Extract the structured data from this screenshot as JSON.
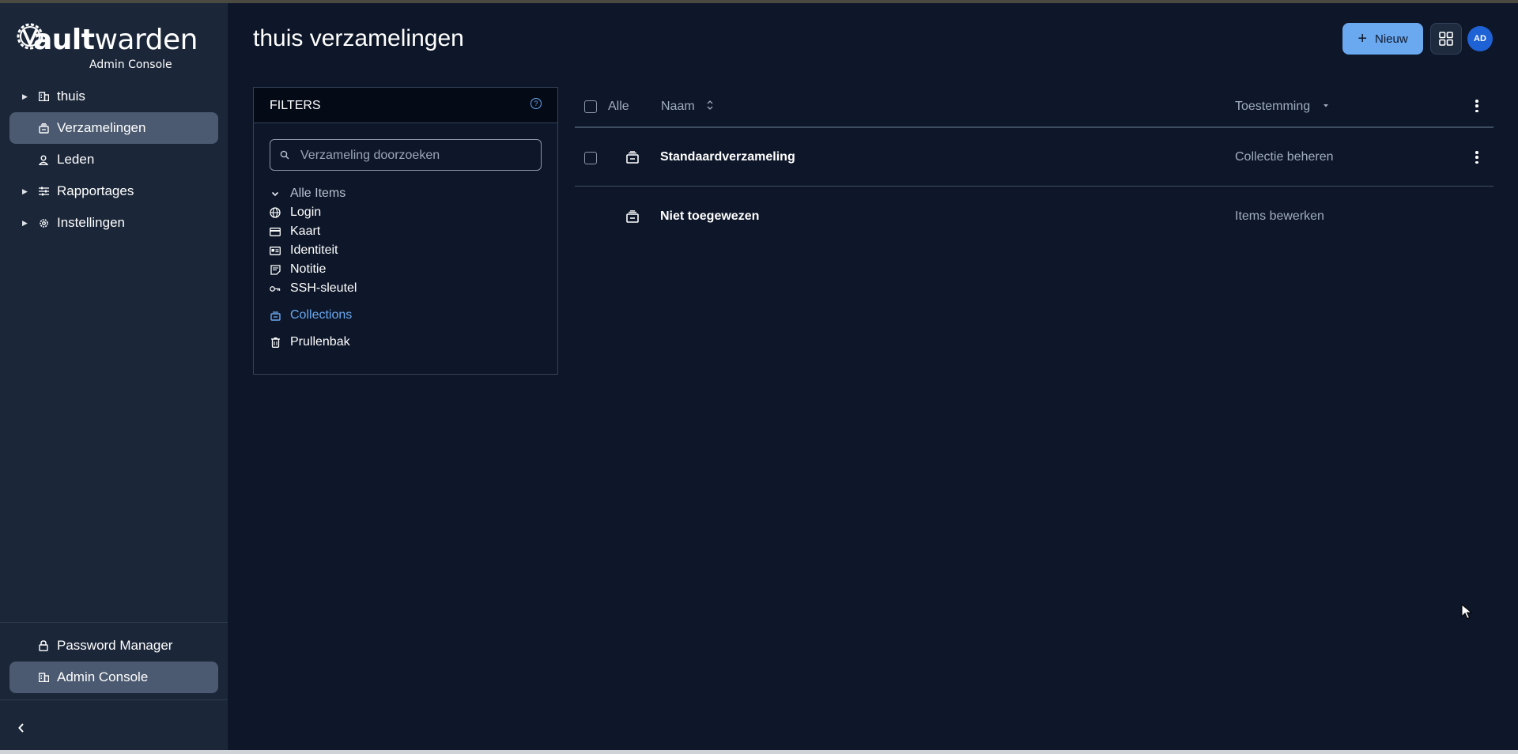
{
  "brand": {
    "logo_word_bold": "ault",
    "logo_word_rest": "warden",
    "logo_subtitle": "Admin Console"
  },
  "sidebar": {
    "items": [
      {
        "label": "thuis",
        "icon": "business-icon",
        "expandable": true,
        "active": false
      },
      {
        "label": "Verzamelingen",
        "icon": "collection-icon",
        "expandable": false,
        "active": true
      },
      {
        "label": "Leden",
        "icon": "user-icon",
        "expandable": false,
        "active": false
      },
      {
        "label": "Rapportages",
        "icon": "sliders-icon",
        "expandable": true,
        "active": false
      },
      {
        "label": "Instellingen",
        "icon": "gear-icon",
        "expandable": true,
        "active": false
      }
    ],
    "footer_items": [
      {
        "label": "Password Manager",
        "icon": "lock-icon",
        "active": false
      },
      {
        "label": "Admin Console",
        "icon": "business-icon",
        "active": true
      }
    ],
    "collapse_icon": "chevron-left-icon"
  },
  "header": {
    "title": "thuis verzamelingen",
    "new_button_label": "Nieuw",
    "new_button_icon": "plus-icon",
    "apps_icon": "grid-icon",
    "avatar_initials": "AD",
    "avatar_color": "#1f62d6"
  },
  "filters": {
    "title": "FILTERS",
    "help_icon": "help-icon",
    "search_placeholder": "Verzameling doorzoeken",
    "search_value": "",
    "all_items_label": "Alle Items",
    "types": [
      {
        "label": "Login",
        "icon": "globe-icon"
      },
      {
        "label": "Kaart",
        "icon": "credit-card-icon"
      },
      {
        "label": "Identiteit",
        "icon": "id-card-icon"
      },
      {
        "label": "Notitie",
        "icon": "note-icon"
      },
      {
        "label": "SSH-sleutel",
        "icon": "key-icon"
      }
    ],
    "collections_label": "Collections",
    "trash_label": "Prullenbak"
  },
  "table": {
    "select_all_label": "Alle",
    "col_name": "Naam",
    "col_permission": "Toestemming",
    "rows": [
      {
        "name": "Standaardverzameling",
        "permission": "Collectie beheren",
        "has_checkbox": true,
        "has_menu": true
      },
      {
        "name": "Niet toegewezen",
        "permission": "Items bewerken",
        "has_checkbox": false,
        "has_menu": false
      }
    ]
  },
  "colors": {
    "accent": "#6aa8f0",
    "sidebar_bg": "#1b2739",
    "page_bg": "#0e1729",
    "active_item_bg": "#4b5a70"
  }
}
